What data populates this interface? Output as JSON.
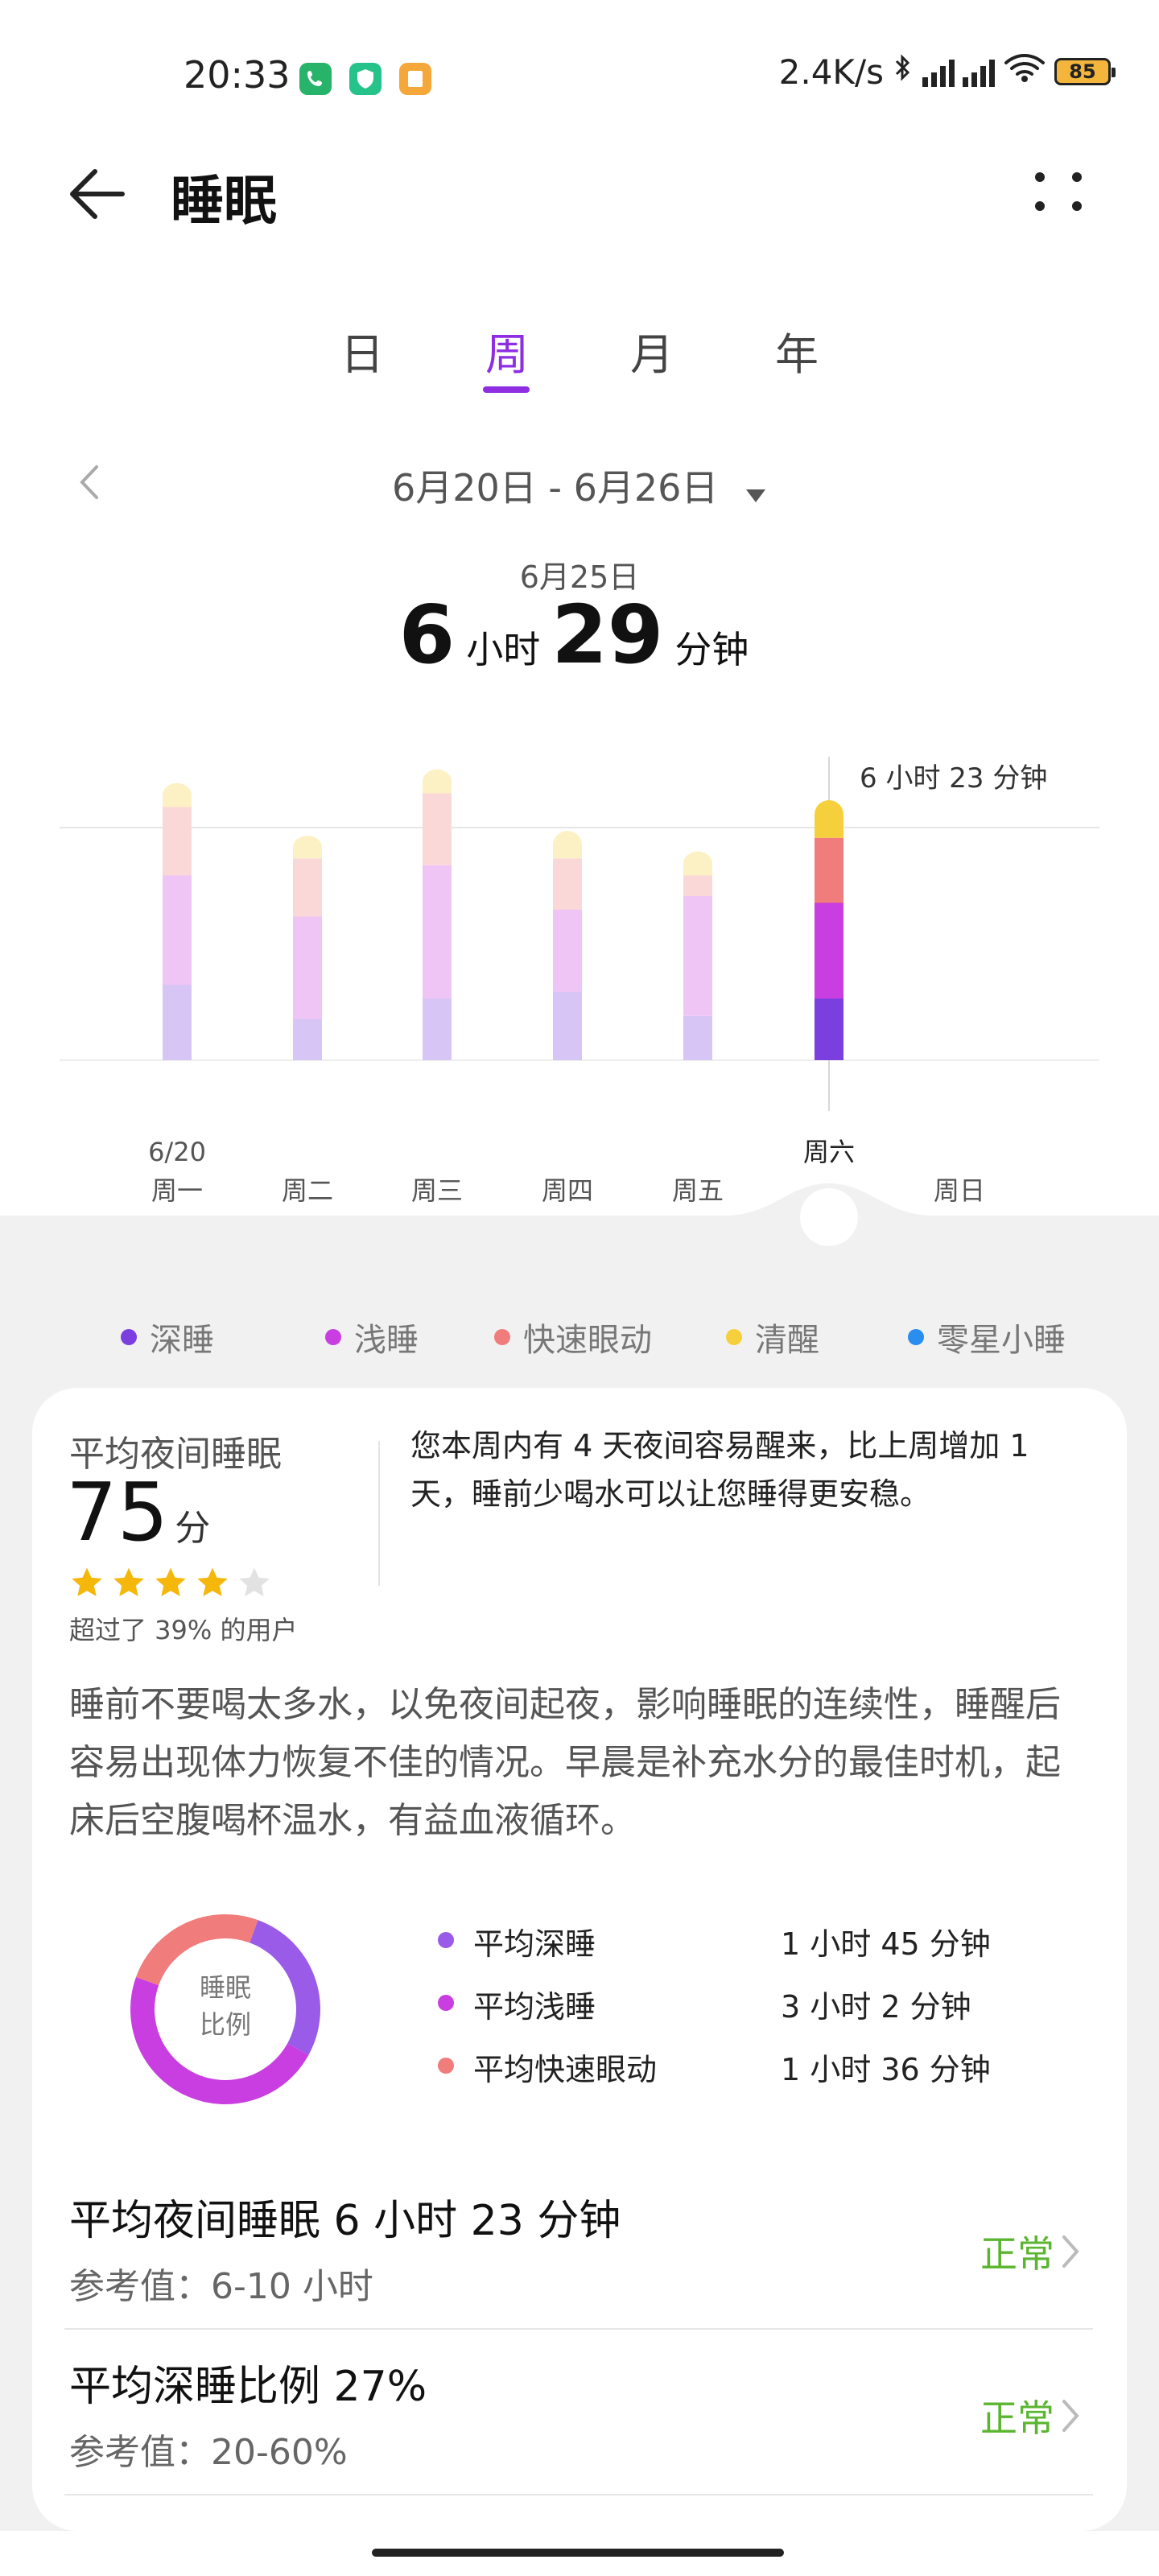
{
  "status_bar": {
    "time": "20:33",
    "net_speed": "2.4K/s",
    "battery": "85",
    "icons": [
      "phone-app-icon",
      "shield-app-icon",
      "notes-app-icon",
      "bluetooth-icon",
      "signal-hd-icon",
      "signal-hd-icon",
      "wifi-icon",
      "battery-icon"
    ]
  },
  "header": {
    "title": "睡眠",
    "back_icon": "back-arrow-icon",
    "more_icon": "more-dots-icon"
  },
  "tabs": [
    {
      "label": "日",
      "active": false
    },
    {
      "label": "周",
      "active": true
    },
    {
      "label": "月",
      "active": false
    },
    {
      "label": "年",
      "active": false
    }
  ],
  "date_nav": {
    "range": "6月20日 - 6月26日",
    "prev_icon": "chevron-left-icon",
    "dropdown_icon": "caret-down-icon"
  },
  "selected": {
    "date": "6月25日",
    "hours": "6",
    "hours_unit": "小时",
    "minutes": "29",
    "minutes_unit": "分钟"
  },
  "chart_data": {
    "type": "bar",
    "stacked": true,
    "categories": [
      "周一",
      "周二",
      "周三",
      "周四",
      "周五",
      "周六",
      "周日"
    ],
    "top_date_label": "6/20",
    "selected_index": 5,
    "reference_label": "6 小时 23 分钟",
    "series": [
      {
        "name": "深睡",
        "color": "#7b3fe0",
        "values": [
          1.1,
          0.6,
          0.9,
          1.0,
          0.65,
          0.9,
          0
        ]
      },
      {
        "name": "浅睡",
        "color": "#c93ee0",
        "values": [
          1.6,
          1.5,
          1.95,
          1.2,
          1.75,
          1.4,
          0
        ]
      },
      {
        "name": "快速眼动",
        "color": "#f07c7c",
        "values": [
          1.0,
          0.85,
          1.05,
          0.75,
          0.3,
          0.95,
          0
        ]
      },
      {
        "name": "清醒",
        "color": "#f6cf3c",
        "values": [
          0.35,
          0.33,
          0.35,
          0.4,
          0.35,
          0.55,
          0
        ]
      }
    ],
    "reference_line_value": 3.4
  },
  "legend": [
    {
      "label": "深睡",
      "color": "#7b3fe0"
    },
    {
      "label": "浅睡",
      "color": "#c93ee0"
    },
    {
      "label": "快速眼动",
      "color": "#f07c7c"
    },
    {
      "label": "清醒",
      "color": "#f6cf3c"
    },
    {
      "label": "零星小睡",
      "color": "#2a8df0"
    }
  ],
  "score": {
    "title": "平均夜间睡眠",
    "value": "75",
    "unit": "分",
    "stars": 4,
    "stars_total": 5,
    "percentile": "超过了 39% 的用户",
    "message": "您本周内有 4 天夜间容易醒来，比上周增加 1 天，睡前少喝水可以让您睡得更安稳。"
  },
  "advice": "睡前不要喝太多水，以免夜间起夜，影响睡眠的连续性，睡醒后容易出现体力恢复不佳的情况。早晨是补充水分的最佳时机，起床后空腹喝杯温水，有益血液循环。",
  "donut": {
    "center_line1": "睡眠",
    "center_line2": "比例",
    "segments": [
      {
        "label": "平均深睡",
        "value": "1 小时 45 分钟",
        "minutes": 105,
        "color": "#9a5be8"
      },
      {
        "label": "平均浅睡",
        "value": "3 小时 2 分钟",
        "minutes": 182,
        "color": "#c93ee0"
      },
      {
        "label": "平均快速眼动",
        "value": "1 小时 36 分钟",
        "minutes": 96,
        "color": "#f07c7c"
      }
    ]
  },
  "metrics": [
    {
      "title": "平均夜间睡眠  6 小时 23 分钟",
      "ref": "参考值：6-10 小时",
      "status": "正常"
    },
    {
      "title": "平均深睡比例  27%",
      "ref": "参考值：20-60%",
      "status": "正常"
    }
  ],
  "colors": {
    "accent": "#8e2de2",
    "normal": "#5bb531"
  }
}
